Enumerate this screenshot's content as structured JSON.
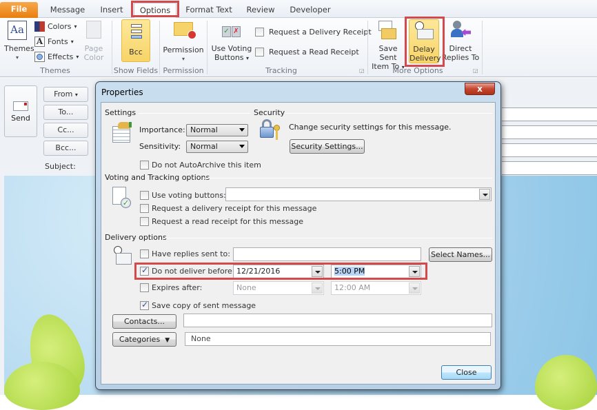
{
  "tabs": [
    {
      "label": "File",
      "active": false
    },
    {
      "label": "Message",
      "active": false
    },
    {
      "label": "Insert",
      "active": false
    },
    {
      "label": "Options",
      "active": true,
      "highlighted": true
    },
    {
      "label": "Format Text",
      "active": false
    },
    {
      "label": "Review",
      "active": false
    },
    {
      "label": "Developer",
      "active": false
    }
  ],
  "ribbon": {
    "themes": {
      "themes_label": "Themes",
      "colors_label": "Colors",
      "fonts_label": "Fonts",
      "effects_label": "Effects",
      "page_color_line1": "Page",
      "page_color_line2": "Color",
      "group_label": "Themes"
    },
    "show_fields": {
      "bcc_label": "Bcc",
      "group_label": "Show Fields"
    },
    "permission": {
      "permission_label": "Permission",
      "group_label": "Permission"
    },
    "tracking": {
      "voting_line1": "Use Voting",
      "voting_line2": "Buttons",
      "delivery_receipt": "Request a Delivery Receipt",
      "read_receipt": "Request a Read Receipt",
      "group_label": "Tracking"
    },
    "more_options": {
      "save_sent_line1": "Save Sent",
      "save_sent_line2": "Item To",
      "delay_line1": "Delay",
      "delay_line2": "Delivery",
      "direct_line1": "Direct",
      "direct_line2": "Replies To",
      "group_label": "More Options"
    }
  },
  "compose": {
    "send_label": "Send",
    "from_label": "From",
    "to_label": "To...",
    "cc_label": "Cc...",
    "bcc_label": "Bcc...",
    "subject_label": "Subject:"
  },
  "dialog": {
    "title": "Properties",
    "close_glyph": "x",
    "settings": {
      "heading": "Settings",
      "importance_label": "Importance:",
      "importance_value": "Normal",
      "sensitivity_label": "Sensitivity:",
      "sensitivity_value": "Normal",
      "autoarchive_label": "Do not AutoArchive this item",
      "autoarchive_checked": false
    },
    "security": {
      "heading": "Security",
      "description": "Change security settings for this message.",
      "button_label": "Security Settings..."
    },
    "voting": {
      "heading": "Voting and Tracking options",
      "use_voting_label": "Use voting buttons:",
      "use_voting_value": "",
      "delivery_receipt_label": "Request a delivery receipt for this message",
      "read_receipt_label": "Request a read receipt for this message"
    },
    "delivery": {
      "heading": "Delivery options",
      "replies_label": "Have replies sent to:",
      "replies_value": "",
      "select_names_label": "Select Names...",
      "do_not_deliver_label": "Do not deliver before:",
      "do_not_deliver_checked": true,
      "deliver_date": "12/21/2016",
      "deliver_time": "5:00 PM",
      "expires_label": "Expires after:",
      "expires_checked": false,
      "expires_date": "None",
      "expires_time": "12:00 AM",
      "save_copy_label": "Save copy of sent message",
      "save_copy_checked": true
    },
    "contacts_label": "Contacts...",
    "contacts_value": "",
    "categories_label": "Categories",
    "categories_value": "None",
    "close_label": "Close"
  }
}
